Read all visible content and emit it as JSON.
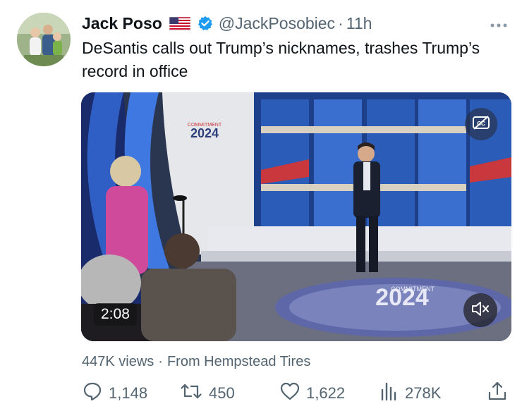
{
  "tweet": {
    "author_name": "Jack Poso",
    "handle": "@JackPosobiec",
    "separator": "·",
    "time": "11h",
    "text": "DeSantis calls out Trump’s nicknames, trashes Trump’s record in office"
  },
  "media": {
    "duration": "2:08",
    "stage_logo_small_label": "COMMITMENT",
    "stage_logo_small_year": "2024",
    "floor_logo_label": "COMMITMENT",
    "floor_logo_year": "2024"
  },
  "meta": {
    "views": "447K views",
    "separator": "·",
    "source": "From Hempstead Tires"
  },
  "actions": {
    "replies": "1,148",
    "reposts": "450",
    "likes": "1,622",
    "views": "278K"
  },
  "colors": {
    "text": "#0f1419",
    "secondary": "#536471",
    "verified": "#1d9bf0"
  },
  "icons": [
    "flag-icon",
    "verified-icon",
    "more-icon",
    "cc-icon",
    "mute-icon",
    "reply-icon",
    "repost-icon",
    "like-icon",
    "views-icon",
    "share-icon"
  ]
}
